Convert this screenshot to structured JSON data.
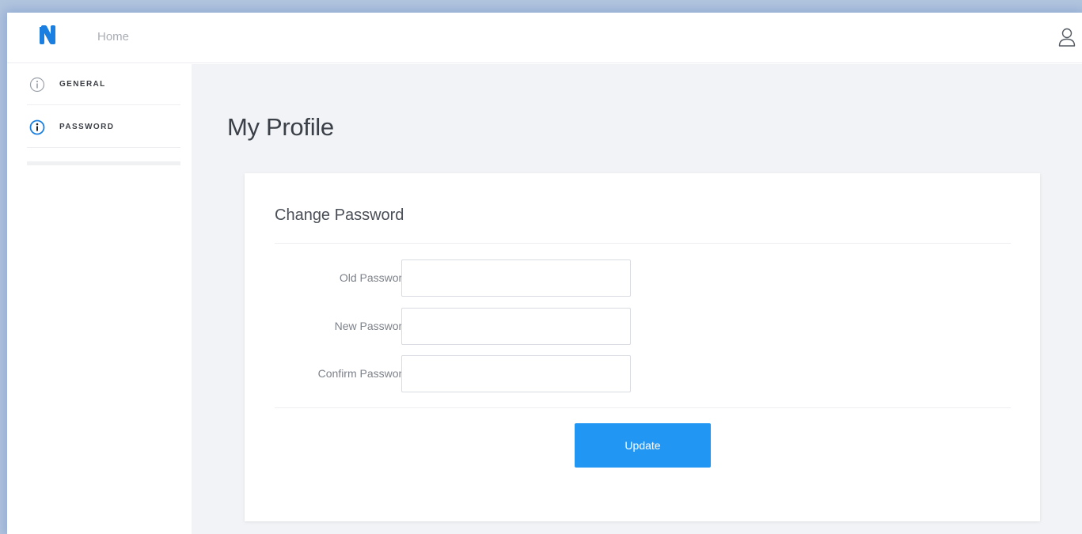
{
  "topbar": {
    "home_label": "Home",
    "logo_icon": "n-logo-icon",
    "user_icon": "user-icon"
  },
  "sidebar": {
    "items": [
      {
        "label": "GENERAL",
        "icon": "info-icon",
        "active": false
      },
      {
        "label": "PASSWORD",
        "icon": "info-icon",
        "active": true
      }
    ]
  },
  "main": {
    "title": "My Profile",
    "card": {
      "title": "Change Password",
      "fields": [
        {
          "label": "Old Password",
          "value": ""
        },
        {
          "label": "New Password",
          "value": ""
        },
        {
          "label": "Confirm Password",
          "value": ""
        }
      ],
      "submit_label": "Update"
    }
  },
  "colors": {
    "accent": "#2196f3",
    "logo": "#1a7fe0",
    "content_bg": "#f1f3f6",
    "outer_bg": "#b3c6df"
  }
}
